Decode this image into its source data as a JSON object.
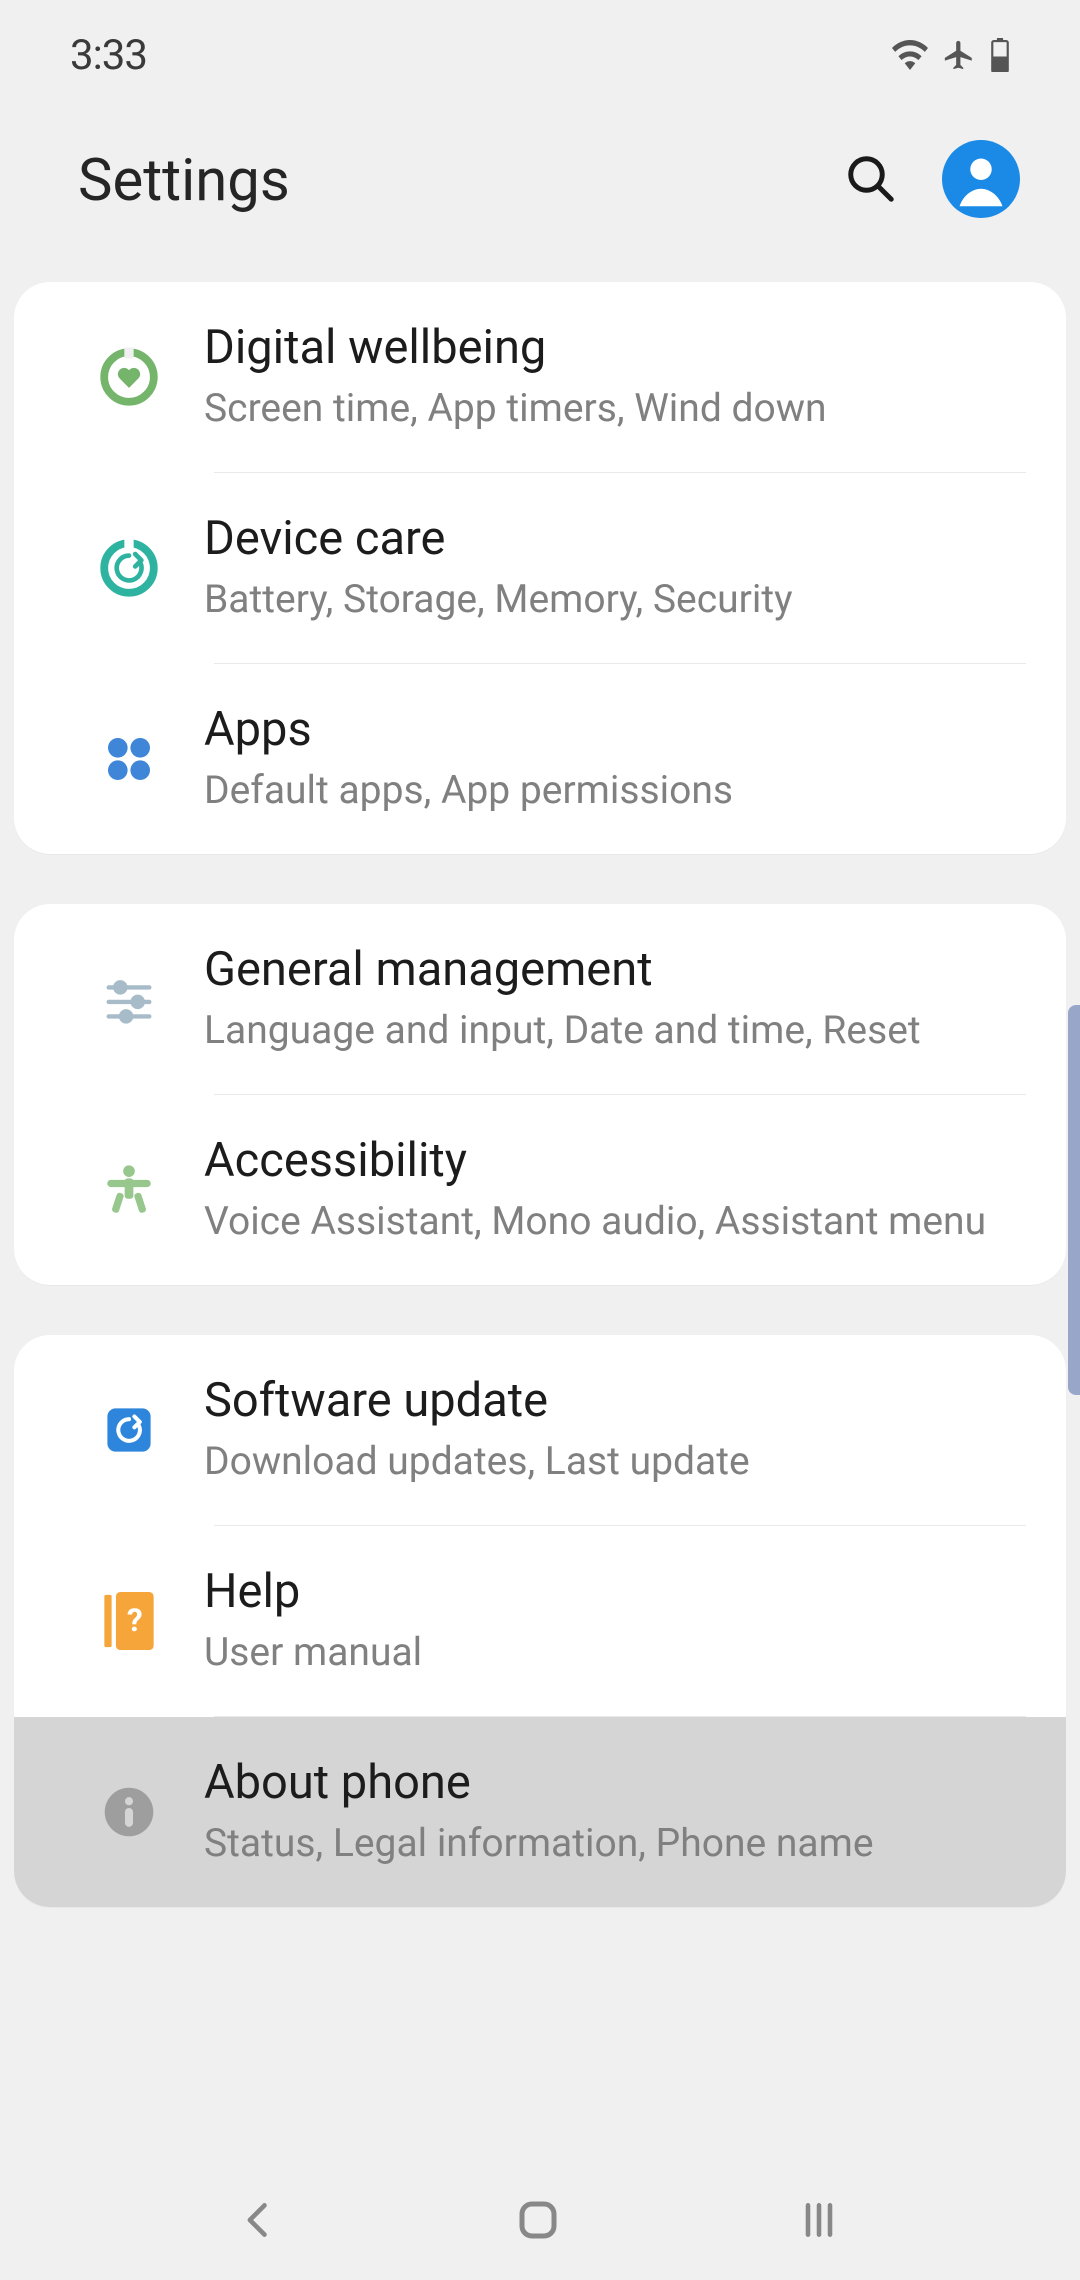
{
  "status": {
    "time": "3:33"
  },
  "header": {
    "title": "Settings"
  },
  "groups": [
    {
      "rows": [
        {
          "key": "digital-wellbeing",
          "title": "Digital wellbeing",
          "sub": "Screen time, App timers, Wind down"
        },
        {
          "key": "device-care",
          "title": "Device care",
          "sub": "Battery, Storage, Memory, Security"
        },
        {
          "key": "apps",
          "title": "Apps",
          "sub": "Default apps, App permissions"
        }
      ]
    },
    {
      "rows": [
        {
          "key": "general-management",
          "title": "General management",
          "sub": "Language and input, Date and time, Reset"
        },
        {
          "key": "accessibility",
          "title": "Accessibility",
          "sub": "Voice Assistant, Mono audio, Assistant menu"
        }
      ]
    },
    {
      "rows": [
        {
          "key": "software-update",
          "title": "Software update",
          "sub": "Download updates, Last update"
        },
        {
          "key": "help",
          "title": "Help",
          "sub": "User manual"
        },
        {
          "key": "about-phone",
          "title": "About phone",
          "sub": "Status, Legal information, Phone name"
        }
      ]
    }
  ],
  "icons": {
    "digital-wellbeing": "wellbeing-icon",
    "device-care": "device-care-icon",
    "apps": "apps-icon",
    "general-management": "sliders-icon",
    "accessibility": "accessibility-icon",
    "software-update": "update-icon",
    "help": "help-icon",
    "about-phone": "info-icon"
  },
  "colors": {
    "wellbeing": "#75b46b",
    "care": "#2fb3a1",
    "apps": "#3f86d8",
    "sliders": "#a7bbc9",
    "access": "#97c78d",
    "update": "#2d86db",
    "help": "#f5a53a",
    "info": "#9e9e9e",
    "avatar": "#1a8ae6"
  },
  "selected_row": "about-phone"
}
